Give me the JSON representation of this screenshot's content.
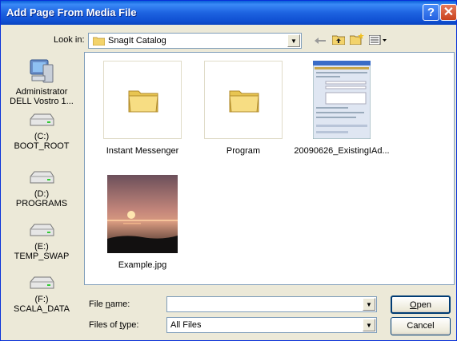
{
  "window": {
    "title": "Add Page From Media File",
    "help_glyph": "?",
    "close_glyph": "✕"
  },
  "lookin": {
    "label": "Look in:",
    "value": "SnagIt Catalog"
  },
  "toolbar": {
    "back_icon": "back-arrow-icon",
    "up_icon": "up-folder-icon",
    "new_folder_icon": "new-folder-icon",
    "views_icon": "views-menu-icon"
  },
  "places": [
    {
      "label1": "Administrator",
      "label2": "DELL Vostro 1...",
      "icon": "computer-icon"
    },
    {
      "label1": "(C:)",
      "label2": "BOOT_ROOT",
      "icon": "drive-icon"
    },
    {
      "label1": "(D:)",
      "label2": "PROGRAMS",
      "icon": "drive-icon"
    },
    {
      "label1": "(E:)",
      "label2": "TEMP_SWAP",
      "icon": "drive-icon"
    },
    {
      "label1": "(F:)",
      "label2": "SCALA_DATA",
      "icon": "drive-icon"
    }
  ],
  "files": [
    {
      "name": "Instant Messenger",
      "type": "folder"
    },
    {
      "name": "Program",
      "type": "folder"
    },
    {
      "name": "20090626_ExistingIAd...",
      "type": "screenshot"
    },
    {
      "name": "Example.jpg",
      "type": "photo"
    }
  ],
  "filename": {
    "label_pre": "File ",
    "label_u": "n",
    "label_post": "ame:",
    "value": ""
  },
  "filetype": {
    "label_pre": "Files of ",
    "label_u": "t",
    "label_post": "ype:",
    "value": "All Files"
  },
  "buttons": {
    "open_u": "O",
    "open_rest": "pen",
    "cancel": "Cancel"
  }
}
